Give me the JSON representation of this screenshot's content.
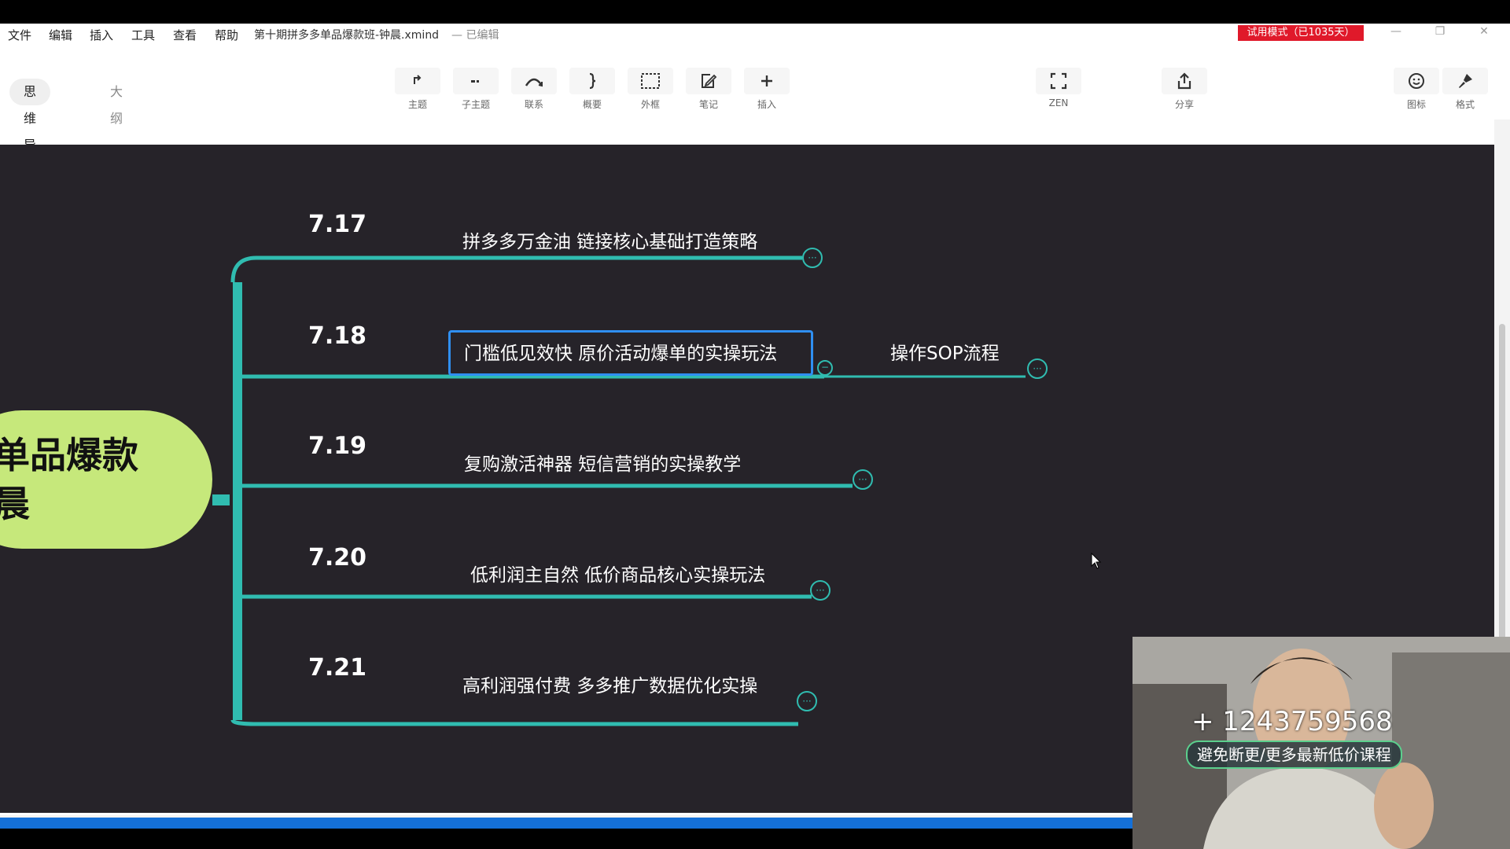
{
  "menu": [
    "文件",
    "编辑",
    "插入",
    "工具",
    "查看",
    "帮助"
  ],
  "document": {
    "title": "第十期拼多多单品爆款班-钟晨.xmind",
    "status": "— 已编辑"
  },
  "trial_badge": "试用模式（已1035天）",
  "window_controls": {
    "minimize": "—",
    "restore": "❐",
    "close": "✕"
  },
  "view_tabs": {
    "mindmap": "思维导图",
    "outline": "大纲"
  },
  "toolbar": {
    "topic": "主题",
    "subtopic": "子主题",
    "relation": "联系",
    "summary": "概要",
    "boundary": "外框",
    "note": "笔记",
    "insert": "插入",
    "zen": "ZEN",
    "share": "分享",
    "icon": "图标",
    "format": "格式"
  },
  "mindmap": {
    "root_text": "单品爆款\n晨",
    "branches": [
      {
        "date": "7.17",
        "topic": "拼多多万金油  链接核心基础打造策略"
      },
      {
        "date": "7.18",
        "topic": "门槛低见效快  原价活动爆单的实操玩法",
        "child": "操作SOP流程"
      },
      {
        "date": "7.19",
        "topic": "复购激活神器   短信营销的实操教学"
      },
      {
        "date": "7.20",
        "topic": "低利润主自然   低价商品核心实操玩法"
      },
      {
        "date": "7.21",
        "topic": "高利润强付费  多多推广数据优化实操"
      }
    ],
    "collapse_glyph": "···",
    "expanded_glyph": "−"
  },
  "webcam_overlay": {
    "contact": "+ 1243759568",
    "slogan": "避免断更/更多最新低价课程"
  },
  "colors": {
    "canvas": "#262329",
    "branch": "#30bcb0",
    "root": "#c6e87b",
    "selection": "#2f8ff2",
    "trial": "#e0192a"
  }
}
